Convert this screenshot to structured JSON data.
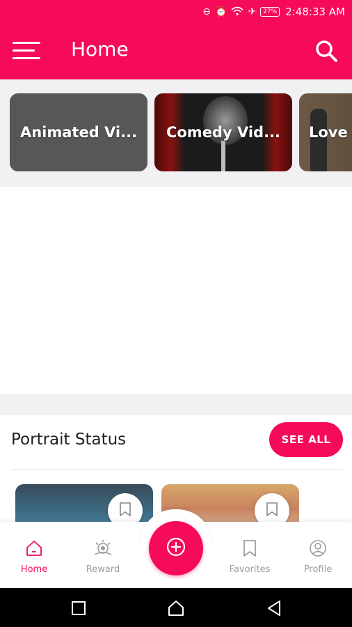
{
  "status_bar": {
    "time": "2:48:33 AM",
    "battery": "27%",
    "icons": [
      "do-not-disturb-icon",
      "alarm-icon",
      "wifi-icon",
      "airplane-icon",
      "battery-icon"
    ]
  },
  "app_bar": {
    "title": "Home",
    "menu_icon": "hamburger-menu-icon",
    "search_icon": "search-icon"
  },
  "categories": [
    {
      "label": "Animated Vi..."
    },
    {
      "label": "Comedy Vid..."
    },
    {
      "label": "Love V"
    }
  ],
  "portrait_section": {
    "title": "Portrait Status",
    "see_all_label": "SEE ALL"
  },
  "bottom_nav": {
    "items": [
      {
        "label": "Home",
        "icon": "home-icon",
        "active": true
      },
      {
        "label": "Reward",
        "icon": "reward-icon",
        "active": false
      },
      {
        "label": "Favorites",
        "icon": "bookmark-icon",
        "active": false
      },
      {
        "label": "Profile",
        "icon": "profile-icon",
        "active": false
      }
    ],
    "fab_icon": "add-circle-icon"
  },
  "colors": {
    "brand": "#f50b5a",
    "inactive": "#9c9c9c",
    "section_bg": "#f1f1f3"
  }
}
